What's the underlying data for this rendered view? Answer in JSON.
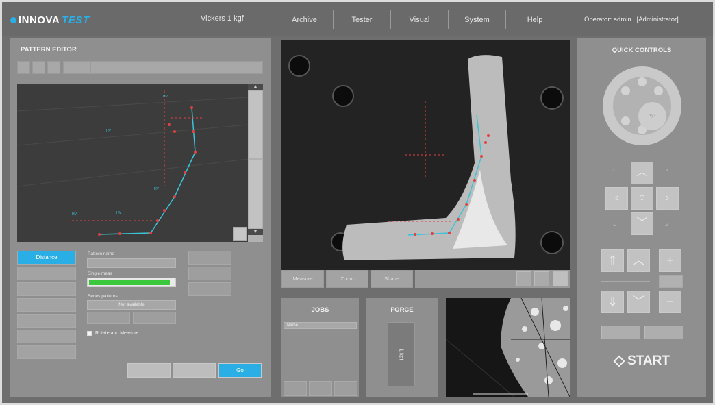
{
  "header": {
    "logo_prefix": "INNOVA",
    "logo_suffix": "TEST",
    "mode": "Vickers 1 kgf",
    "menu": [
      {
        "label": "Archive"
      },
      {
        "label": "Tester"
      },
      {
        "label": "Visual"
      },
      {
        "label": "System"
      },
      {
        "label": "Help"
      }
    ],
    "operator": "Operator: admin",
    "role": "[Administrator]"
  },
  "pattern_editor": {
    "title": "PATTERN EDITOR",
    "side_buttons": [
      {
        "label": "Distance",
        "active": true
      },
      {
        "label": "",
        "active": false
      },
      {
        "label": "",
        "active": false
      },
      {
        "label": "",
        "active": false
      },
      {
        "label": "",
        "active": false
      },
      {
        "label": "",
        "active": false
      },
      {
        "label": "",
        "active": false
      }
    ],
    "pattern_name_label": "Pattern name",
    "single_meas_label": "Single meas",
    "progress_fraction": 0.95,
    "series_label": "Series patterns",
    "series_value": "Not available",
    "checkbox_label": "Rotate and Measure",
    "right_buttons": [
      "",
      "",
      ""
    ],
    "bottom_buttons": [
      {
        "label": "",
        "primary": false
      },
      {
        "label": "",
        "primary": false
      },
      {
        "label": "Go",
        "primary": true
      }
    ]
  },
  "camera": {
    "buttons": [
      "Measure",
      "Zoom",
      "Shape"
    ]
  },
  "jobs": {
    "title": "JOBS",
    "row": "Name"
  },
  "force": {
    "title": "FORCE",
    "value": "1 kgf"
  },
  "quick_controls": {
    "title": "QUICK CONTROLS",
    "ring_center": "xyz",
    "start_label": "START"
  },
  "colors": {
    "accent": "#2aaee6",
    "progress": "#3cc83c",
    "panel": "#8f8f8f",
    "background": "#6e6e6e"
  }
}
